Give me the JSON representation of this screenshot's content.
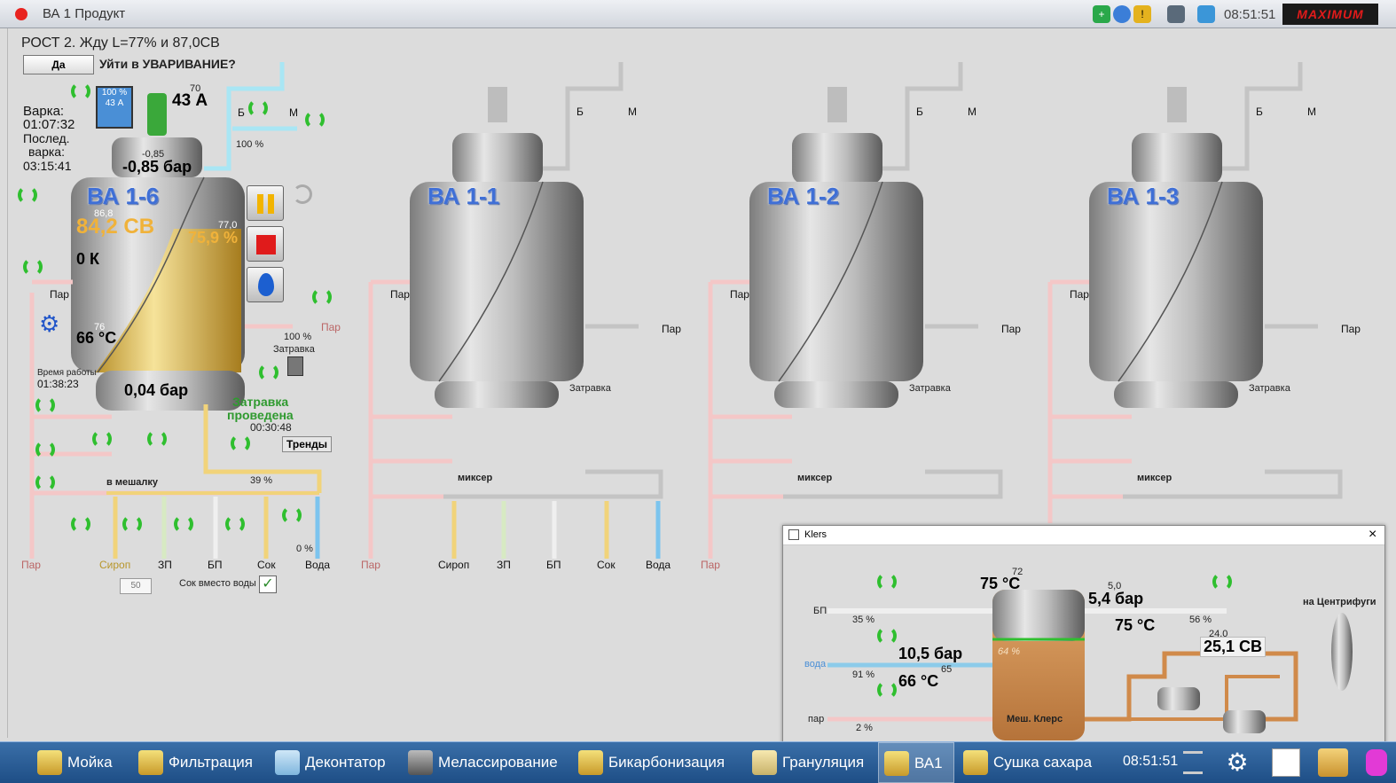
{
  "window": {
    "title": "ВА 1 Продукт",
    "clock": "08:51:51",
    "logo": "MAXIMUM AUTOMATION"
  },
  "header": {
    "status": "РОСТ 2. Жду L=77% и 87,0СВ",
    "yes_button": "Да",
    "question": "Уйти в УВАРИВАНИЕ?"
  },
  "batch": {
    "cook_label": "Варка:",
    "cook_time": "01:07:32",
    "last_label": "Послед.",
    "last_label2": "варка:",
    "last_time": "03:15:41",
    "worktime_label": "Время работы",
    "worktime": "01:38:23"
  },
  "ba16": {
    "title": "ВА 1-6",
    "motor_amps": "43 А",
    "motor_amps_sp": "70",
    "display_pct": "100 %",
    "display_amps": "43 А",
    "valve_top_pct": "100 %",
    "pressure_sp": "-0,85",
    "pressure": "-0,85 бар",
    "brix_sp": "86,8",
    "brix": "84,2 СВ",
    "level_sp": "77,0",
    "level": "75,9 %",
    "k": "0 К",
    "temp_sp": "76",
    "temp": "66 °C",
    "steam_pct": "100 %",
    "bottom_pressure": "0,04 бар",
    "seeding_done": "Затравка",
    "seeding_done2": "проведена",
    "seeding_time": "00:30:48",
    "feed_pct": "39 %",
    "water_pct": "0 %",
    "trends": "Тренды",
    "setpoint_box": "50",
    "juice_instead_water": "Сок вместо воды"
  },
  "labels": {
    "steam": "Пар",
    "seeding": "Затравка",
    "to_mixer": "в мешалку",
    "mixer": "миксер",
    "b": "Б",
    "m": "М",
    "feeds": [
      "Пар",
      "Сироп",
      "ЗП",
      "БП",
      "Сок",
      "Вода"
    ]
  },
  "tanks": [
    {
      "title": "ВА 1-1"
    },
    {
      "title": "ВА 1-2"
    },
    {
      "title": "ВА 1-3"
    }
  ],
  "klers": {
    "title": "Klers",
    "bp": "БП",
    "voda": "вода",
    "par": "пар",
    "bp_pct": "35 %",
    "voda_pct": "91 %",
    "par_pct": "2 %",
    "temp_top_sp": "72",
    "temp_top": "75 °C",
    "pressure_sp": "5,0",
    "pressure": "5,4 бар",
    "right_pct": "56 %",
    "temp_right": "75 °C",
    "water_pressure": "10,5 бар",
    "water_temp_sp": "65",
    "water_temp": "66 °C",
    "level": "64 %",
    "tank_name": "Меш. Клерс",
    "brix_sp": "24,0",
    "brix": "25,1 СВ",
    "to_centrifuge": "на Центрифуги"
  },
  "taskbar": {
    "items": [
      "Мойка",
      "Фильтрация",
      "Деконтатор",
      "Мелассирование",
      "Бикарбонизация",
      "Грануляция",
      "ВА1",
      "Сушка сахара"
    ],
    "clock": "08:51:51"
  },
  "colors": {
    "accent_blue": "#3f6fd6",
    "brix_orange": "#f0b23a",
    "green_ok": "#2fbf2f",
    "stop_red": "#e01b1b"
  }
}
